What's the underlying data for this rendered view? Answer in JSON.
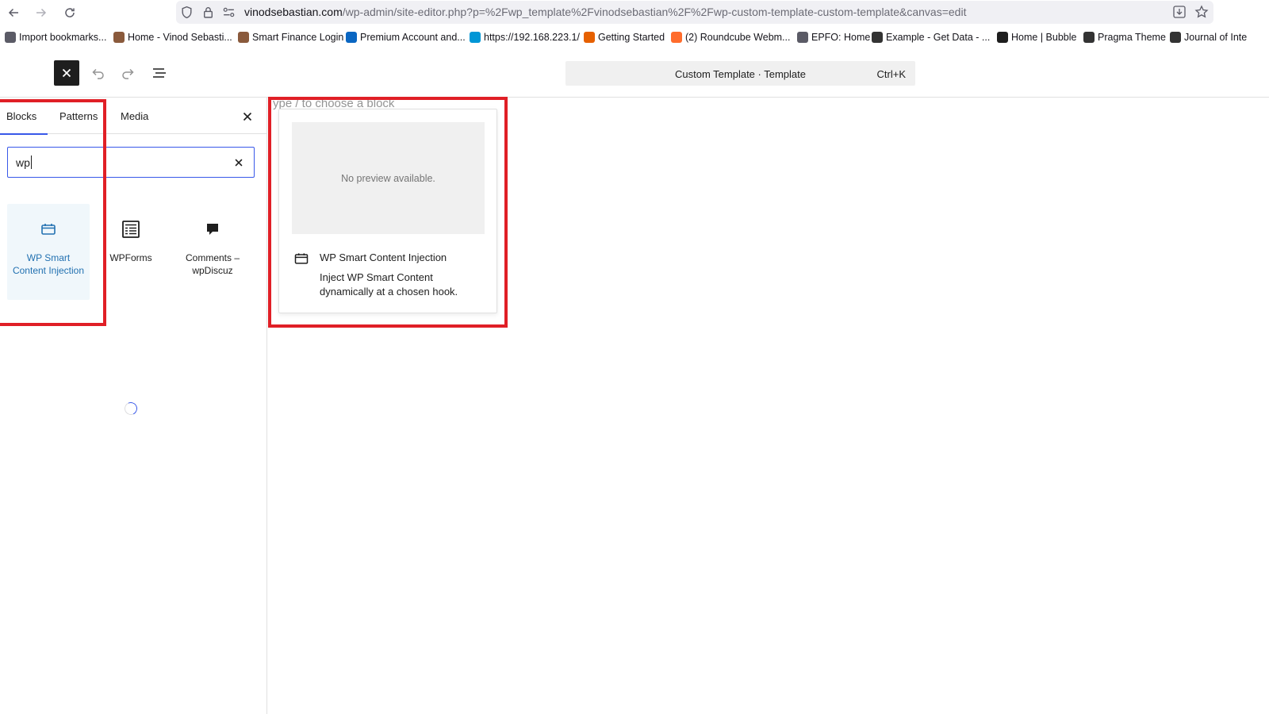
{
  "browser": {
    "url_host": "vinodsebastian.com",
    "url_path": "/wp-admin/site-editor.php?p=%2Fwp_template%2Fvinodsebastian%2F%2Fwp-custom-template-custom-template&canvas=edit",
    "bookmarks": [
      {
        "label": "Import bookmarks...",
        "icon": "import-icon",
        "color": "#5b5b66"
      },
      {
        "label": "Home - Vinod Sebasti...",
        "icon": "avatar-icon",
        "color": "#8a5a3c"
      },
      {
        "label": "Smart Finance Login",
        "icon": "avatar-icon",
        "color": "#8a5a3c"
      },
      {
        "label": "Premium Account and...",
        "icon": "linkedin-icon",
        "color": "#0a66c2"
      },
      {
        "label": "https://192.168.223.1/",
        "icon": "hp-icon",
        "color": "#0096d6"
      },
      {
        "label": "Getting Started",
        "icon": "firefox-icon",
        "color": "#e66000"
      },
      {
        "label": "(2) Roundcube Webm...",
        "icon": "cpanel-icon",
        "color": "#ff6c2c"
      },
      {
        "label": "EPFO: Home",
        "icon": "globe-icon",
        "color": "#5b5b66"
      },
      {
        "label": "Example - Get Data - ...",
        "icon": "pkp-icon",
        "color": "#333333"
      },
      {
        "label": "Home | Bubble",
        "icon": "bubble-icon",
        "color": "#1e1e1e"
      },
      {
        "label": "Pragma Theme",
        "icon": "pkp-icon",
        "color": "#333333"
      },
      {
        "label": "Journal of Inte",
        "icon": "pkp-icon",
        "color": "#333333"
      }
    ]
  },
  "header": {
    "command_title": "Custom Template · Template",
    "command_shortcut": "Ctrl+K"
  },
  "inserter": {
    "tabs": [
      "Blocks",
      "Patterns",
      "Media"
    ],
    "active_tab": "Blocks",
    "search_value": "wp",
    "results": [
      {
        "label": "WP Smart Content Injection",
        "icon": "calendar-icon",
        "selected": true
      },
      {
        "label": "WPForms",
        "icon": "form-icon",
        "selected": false
      },
      {
        "label": "Comments – wpDiscuz",
        "icon": "comment-icon",
        "selected": false
      }
    ]
  },
  "canvas": {
    "placeholder": "ype / to choose a block"
  },
  "preview": {
    "message": "No preview available.",
    "title": "WP Smart Content Injection",
    "description": "Inject WP Smart Content dynamically at a chosen hook."
  },
  "colors": {
    "accent": "#3858e9",
    "selected_text": "#2271b1",
    "annotation": "#e01f26"
  }
}
